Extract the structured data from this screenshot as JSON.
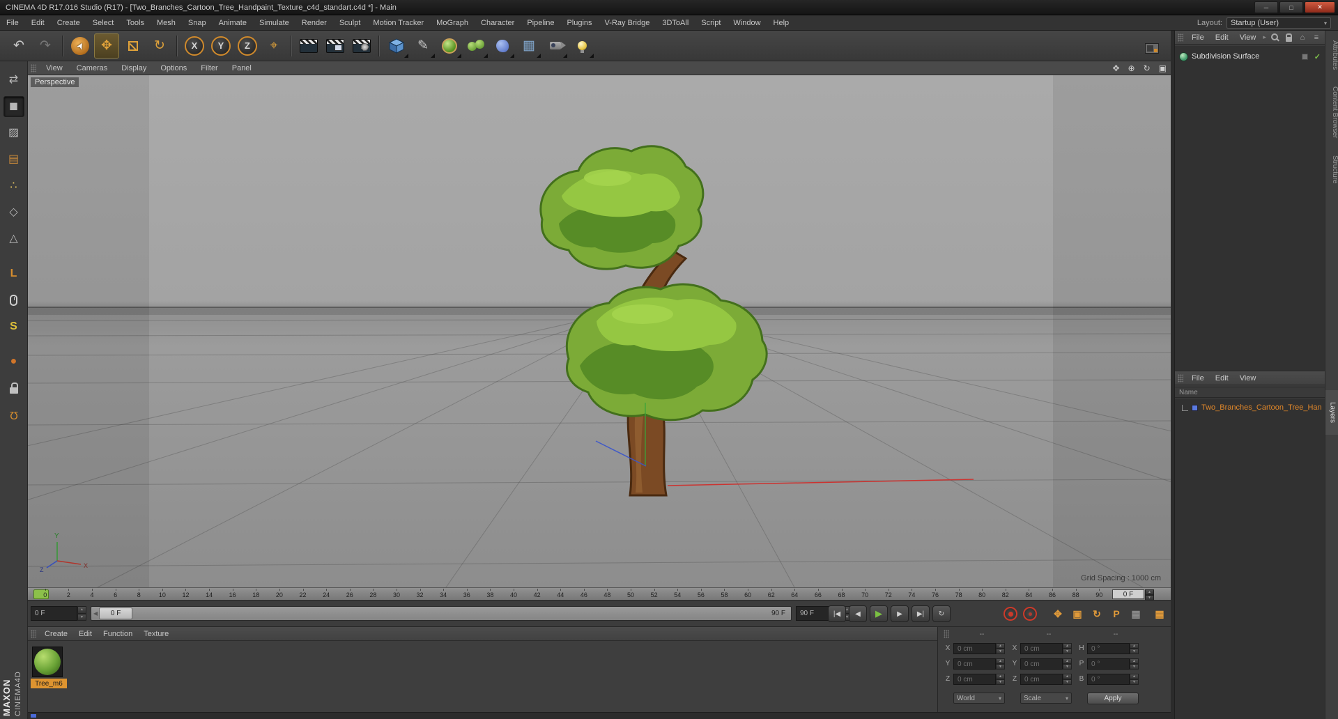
{
  "window": {
    "title": "CINEMA 4D R17.016 Studio (R17) - [Two_Branches_Cartoon_Tree_Handpaint_Texture_c4d_standart.c4d *] - Main",
    "minimize": "─",
    "maximize": "□",
    "close": "✕"
  },
  "menubar": {
    "items": [
      "File",
      "Edit",
      "Create",
      "Select",
      "Tools",
      "Mesh",
      "Snap",
      "Animate",
      "Simulate",
      "Render",
      "Sculpt",
      "Motion Tracker",
      "MoGraph",
      "Character",
      "Pipeline",
      "Plugins",
      "V-Ray Bridge",
      "3DToAll",
      "Script",
      "Window",
      "Help"
    ],
    "layout_label": "Layout:",
    "layout_value": "Startup (User)"
  },
  "toolbar": {
    "undo": "↶",
    "redo": "↷",
    "selection": "➤",
    "move": "✥",
    "rotate": "↻",
    "axis_x": "X",
    "axis_y": "Y",
    "axis_z": "Z",
    "coords": "⌖",
    "pen": "✎",
    "floor": "▦"
  },
  "palette": {
    "tools": [
      {
        "name": "make-editable",
        "glyph": "⇄"
      },
      {
        "name": "model-mode",
        "glyph": "◼"
      },
      {
        "name": "texture-mode",
        "glyph": "▨"
      },
      {
        "name": "workplane-mode",
        "glyph": "▤"
      },
      {
        "name": "points-mode",
        "glyph": "∴"
      },
      {
        "name": "edges-mode",
        "glyph": "◇"
      },
      {
        "name": "polygons-mode",
        "glyph": "△"
      },
      {
        "name": "axis-mode",
        "glyph": "L"
      },
      {
        "name": "navigation-mode",
        "glyph": ""
      },
      {
        "name": "snap-toggle",
        "glyph": "S"
      },
      {
        "name": "paint-tool",
        "glyph": "●"
      },
      {
        "name": "workplane-lock",
        "glyph": ""
      },
      {
        "name": "snap-settings",
        "glyph": "Ω"
      }
    ]
  },
  "viewport": {
    "menu": [
      "View",
      "Cameras",
      "Display",
      "Options",
      "Filter",
      "Panel"
    ],
    "camera": "Perspective",
    "grid_spacing": "Grid Spacing : 1000 cm",
    "pan": "✥",
    "zoom": "⊕",
    "rotate": "↻",
    "maximize": "▣",
    "gizmo_y": "Y",
    "gizmo_x": "X",
    "gizmo_z": "Z"
  },
  "object_manager": {
    "menu": [
      "File",
      "Edit",
      "View"
    ],
    "chevron": "▸",
    "object": "Subdivision Surface",
    "enabled_check": "✓",
    "home": "⌂",
    "menu_icon": "≡"
  },
  "scene_panel": {
    "menu": [
      "File",
      "Edit",
      "View"
    ],
    "name_header": "Name",
    "item": "Two_Branches_Cartoon_Tree_Han"
  },
  "right_tabs": {
    "tabs": [
      "Attributes",
      "Content Browser",
      "Structure"
    ],
    "layers": "Layers"
  },
  "timeline": {
    "ticks": [
      0,
      2,
      4,
      6,
      8,
      10,
      12,
      14,
      16,
      18,
      20,
      22,
      24,
      26,
      28,
      30,
      32,
      34,
      36,
      38,
      40,
      42,
      44,
      46,
      48,
      50,
      52,
      54,
      56,
      58,
      60,
      62,
      64,
      66,
      68,
      70,
      72,
      74,
      76,
      78,
      80,
      82,
      84,
      86,
      88,
      90
    ],
    "ruler_frame": "0 F"
  },
  "transport": {
    "current": "0 F",
    "end": "90 F",
    "slider_current": "0 F",
    "slider_end": "90 F",
    "jump_start": "|◀",
    "prev_frame": "◀",
    "play": "▶",
    "next_frame": "▶",
    "jump_end": "▶|",
    "loop": "↻",
    "key_position": "✥",
    "key_scale": "▣",
    "key_rotation": "↻",
    "key_parameter": "P",
    "key_pla": "▦",
    "key_selection": "▦"
  },
  "materials": {
    "menu": [
      "Create",
      "Edit",
      "Function",
      "Texture"
    ],
    "material_name": "Tree_m6"
  },
  "coordinates": {
    "headers": [
      "--",
      "--",
      "--"
    ],
    "rows": [
      {
        "pos_label": "X",
        "pos": "0 cm",
        "size_label": "X",
        "size": "0 cm",
        "rot_label": "H",
        "rot": "0 °"
      },
      {
        "pos_label": "Y",
        "pos": "0 cm",
        "size_label": "Y",
        "size": "0 cm",
        "rot_label": "P",
        "rot": "0 °"
      },
      {
        "pos_label": "Z",
        "pos": "0 cm",
        "size_label": "Z",
        "size": "0 cm",
        "rot_label": "B",
        "rot": "0 °"
      }
    ],
    "system": "World",
    "mode": "Scale",
    "apply": "Apply"
  },
  "branding": {
    "maxon": "MAXON",
    "product": "CINEMA4D"
  },
  "colors": {
    "accent_orange": "#d98e2e",
    "foliage_green": "#7cab37",
    "trunk_brown": "#7b4a24"
  }
}
